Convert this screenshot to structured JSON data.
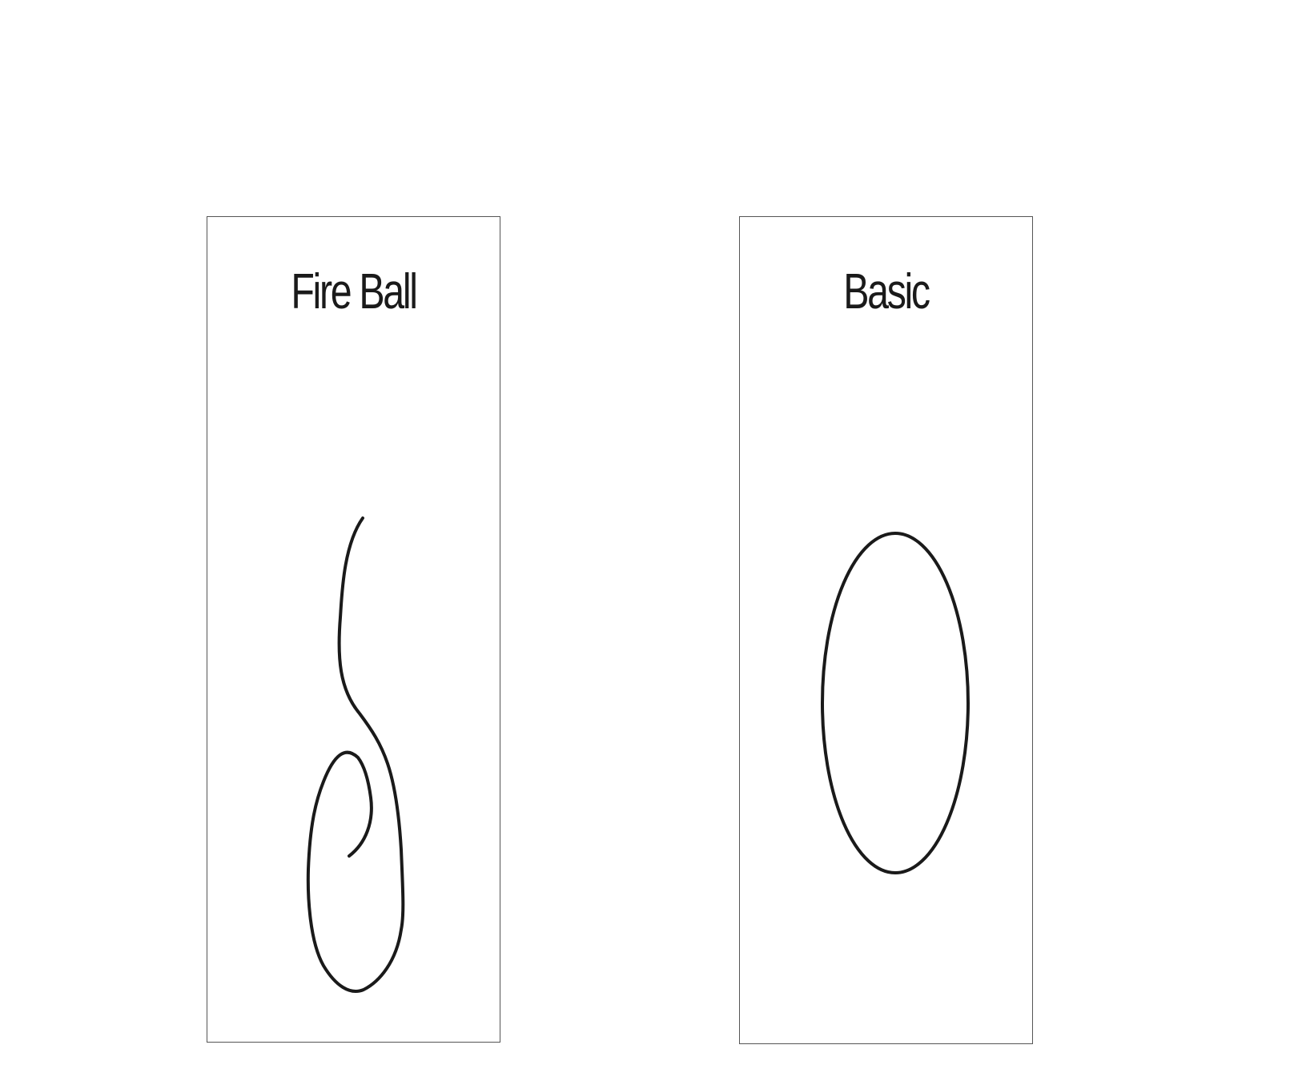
{
  "cards": [
    {
      "title": "Fire Ball",
      "gesture_icon": "fireball-gesture-icon"
    },
    {
      "title": "Basic",
      "gesture_icon": "oval-gesture-icon"
    }
  ],
  "colors": {
    "stroke": "#1a1a1a",
    "border": "#555555",
    "background": "#ffffff"
  }
}
